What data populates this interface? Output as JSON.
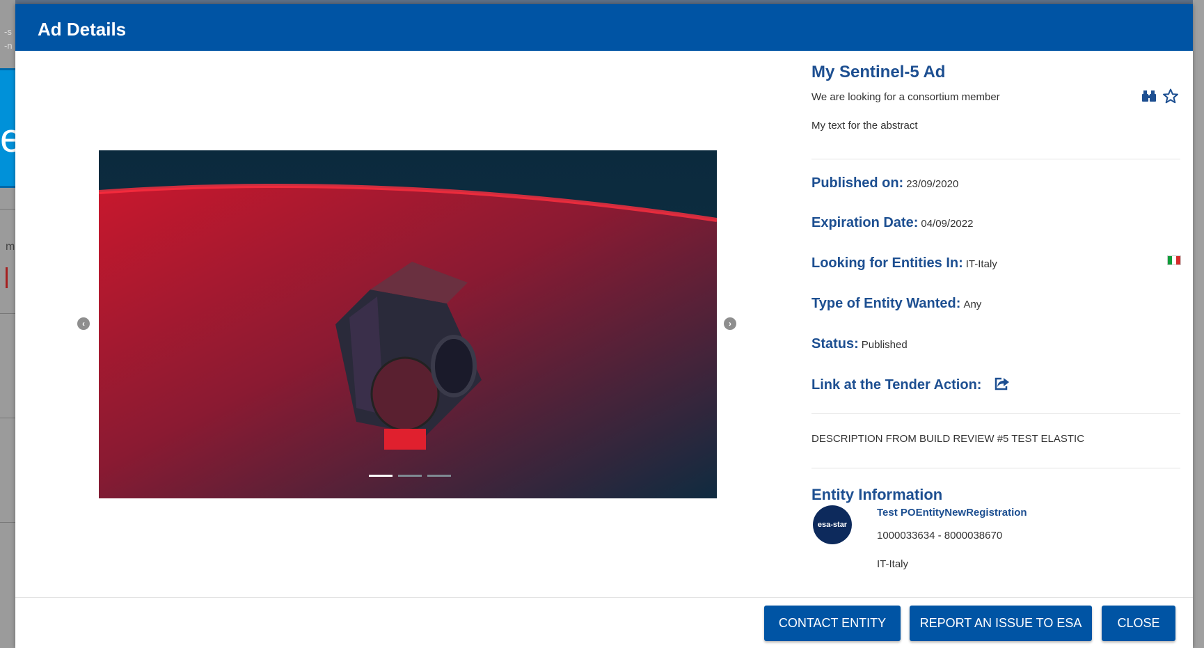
{
  "background": {
    "fragment_top": "-s",
    "fragment_top2": "-n",
    "fragment_mid": "m",
    "callout_text": "e"
  },
  "modal": {
    "title": "Ad Details"
  },
  "carousel": {
    "slide_count": 3,
    "active_index": 0,
    "prev_glyph": "‹",
    "next_glyph": "›"
  },
  "ad": {
    "title": "My Sentinel-5 Ad",
    "subtitle": "We are looking for a consortium member",
    "abstract": "My text for the abstract",
    "published_label": "Published on:",
    "published_value": "23/09/2020",
    "expiration_label": "Expiration Date:",
    "expiration_value": "04/09/2022",
    "entities_in_label": "Looking for Entities In:",
    "entities_in_value": "IT-Italy",
    "type_label": "Type of Entity Wanted:",
    "type_value": "Any",
    "status_label": "Status:",
    "status_value": "Published",
    "link_label": "Link at the Tender Action:",
    "description": "DESCRIPTION FROM BUILD REVIEW #5 TEST ELASTIC",
    "icons": [
      "binoculars-icon",
      "star-outline-icon",
      "external-link-icon",
      "italy-flag-icon"
    ]
  },
  "entity": {
    "heading": "Entity Information",
    "logo_text": "esa-star",
    "name": "Test POEntityNewRegistration",
    "ids": "1000033634 - 8000038670",
    "country": "IT-Italy"
  },
  "footer": {
    "contact_label": "CONTACT ENTITY",
    "report_label": "REPORT AN ISSUE TO ESA",
    "close_label": "CLOSE"
  },
  "colors": {
    "primary": "#0054a4",
    "heading": "#1d4f91",
    "callout": "#0091d9"
  }
}
